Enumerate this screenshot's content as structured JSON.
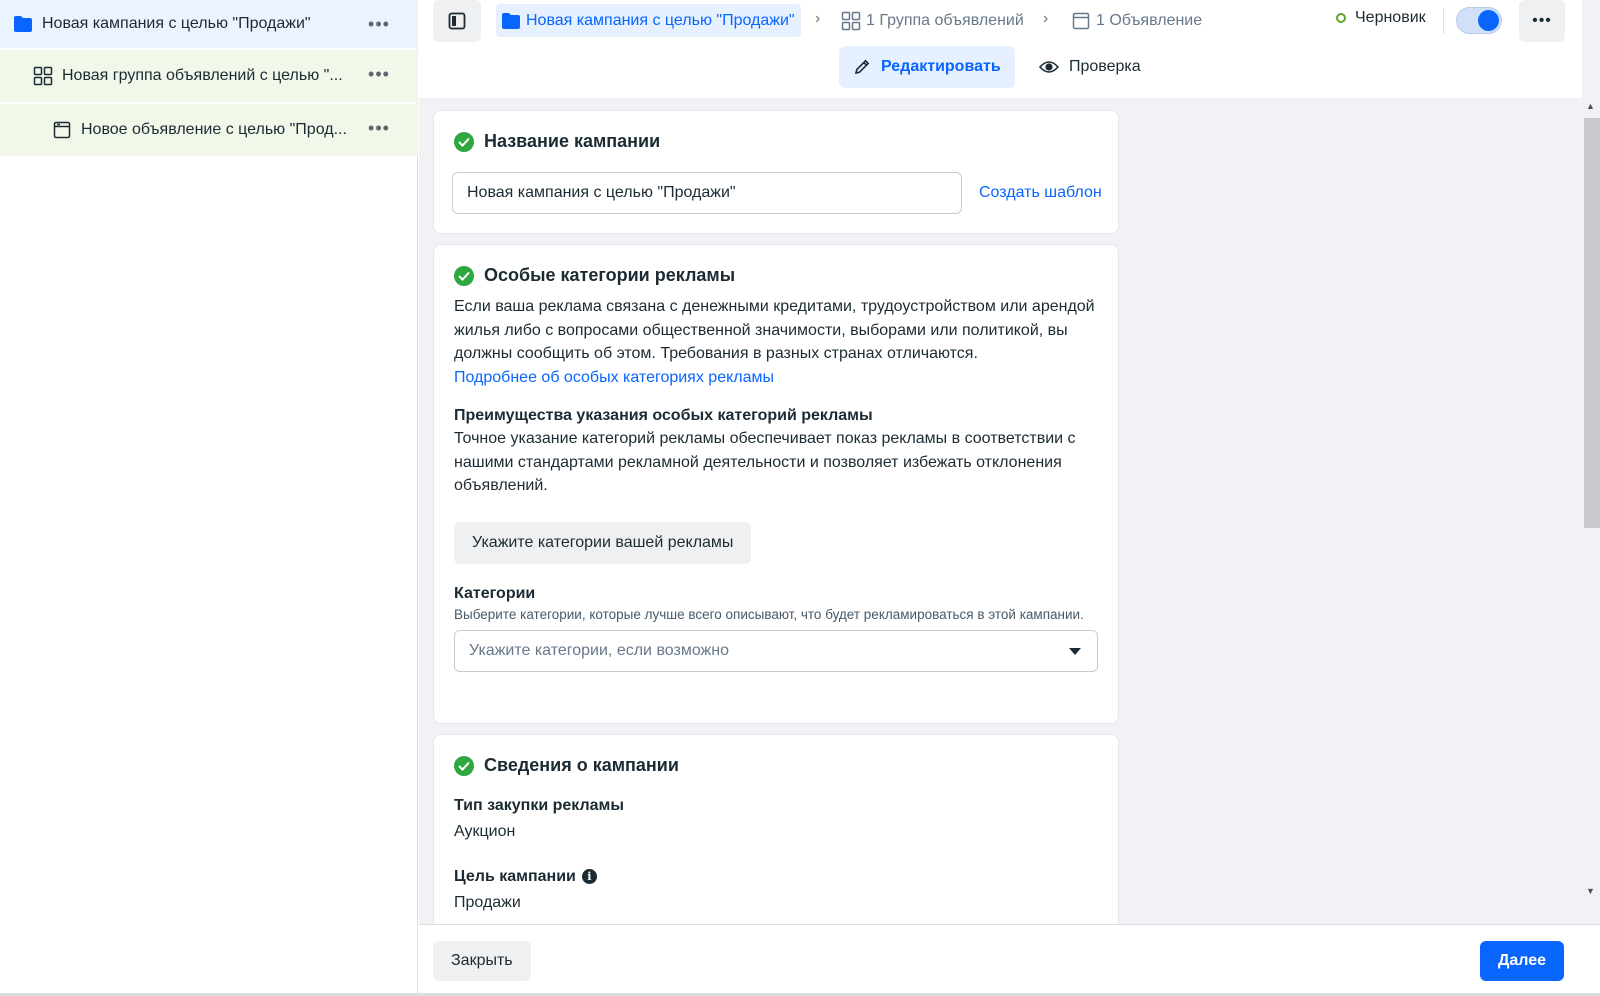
{
  "sidebar": {
    "campaign_label": "Новая кампания с целью \"Продажи\"",
    "adset_label": "Новая группа объявлений с целью \"...",
    "ad_label": "Новое объявление с целью \"Прод...",
    "more_glyph": "•••"
  },
  "topbar": {
    "breadcrumb_campaign": "Новая кампания с целью \"Продажи\"",
    "breadcrumb_adset": "1 Группа объявлений",
    "breadcrumb_ad": "1 Объявление",
    "separator": "›",
    "status": "Черновик",
    "more_glyph": "•••"
  },
  "modes": {
    "edit": "Редактировать",
    "review": "Проверка"
  },
  "campaign_name_card": {
    "title": "Название кампании",
    "name_value": "Новая кампания с целью \"Продажи\"",
    "template_link": "Создать шаблон"
  },
  "special_categories_card": {
    "title": "Особые категории рекламы",
    "description": "Если ваша реклама связана с денежными кредитами, трудоустройством или арендой жилья либо с вопросами общественной значимости, выборами или политикой, вы должны сообщить об этом. Требования в разных странах отличаются.",
    "learn_more": "Подробнее об особых категориях рекламы",
    "benefits_title": "Преимущества указания особых категорий рекламы",
    "benefits_text": "Точное указание категорий рекламы обеспечивает показ рекламы в соответствии с нашими стандартами рекламной деятельности и позволяет избежать отклонения объявлений.",
    "declare_button": "Укажите категории вашей рекламы",
    "categories_label": "Категории",
    "categories_hint": "Выберите категории, которые лучше всего описывают, что будет рекламироваться в этой кампании.",
    "categories_placeholder": "Укажите категории, если возможно"
  },
  "campaign_details_card": {
    "title": "Сведения о кампании",
    "buying_type_label": "Тип закупки рекламы",
    "buying_type_value": "Аукцион",
    "objective_label": "Цель кампании",
    "objective_value": "Продажи"
  },
  "footer": {
    "close": "Закрыть",
    "next": "Далее"
  },
  "colors": {
    "accent": "#0866ff",
    "success": "#2fa741",
    "draft_status": "#5aa92c"
  },
  "toggle": {
    "on": true
  }
}
